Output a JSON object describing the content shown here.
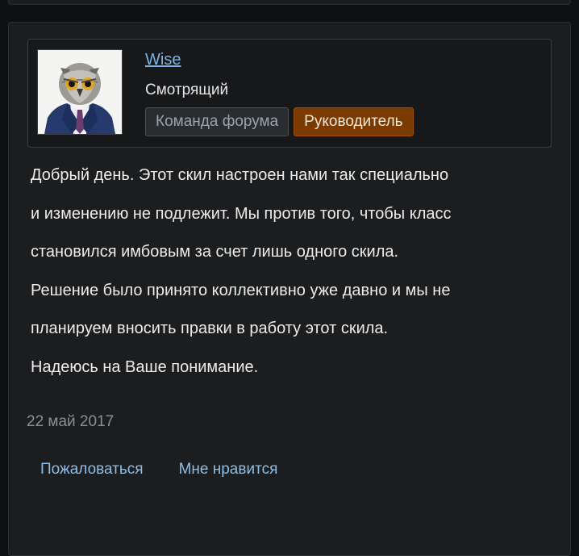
{
  "post": {
    "author": {
      "name": "Wise",
      "title": "Смотрящий",
      "badges": [
        "Команда форума",
        "Руководитель"
      ],
      "avatar_icon": "owl-in-suit-icon"
    },
    "message_lines": [
      "Добрый день. Этот скил настроен нами так специально",
      "и изменению не подлежит. Мы против того, чтобы класс",
      "становился имбовым за счет лишь одного скила.",
      "Решение было принято коллективно уже давно и мы не",
      "планируем вносить правки в работу этот скила.",
      "Надеюсь на Ваше понимание."
    ],
    "date": "22 май 2017",
    "actions": {
      "report": "Пожаловаться",
      "like": "Мне нравится"
    }
  },
  "colors": {
    "background": "#0f1011",
    "panel": "#1c1d1f",
    "link": "#7cb1e6",
    "badge_lead": "#7a3a00"
  }
}
